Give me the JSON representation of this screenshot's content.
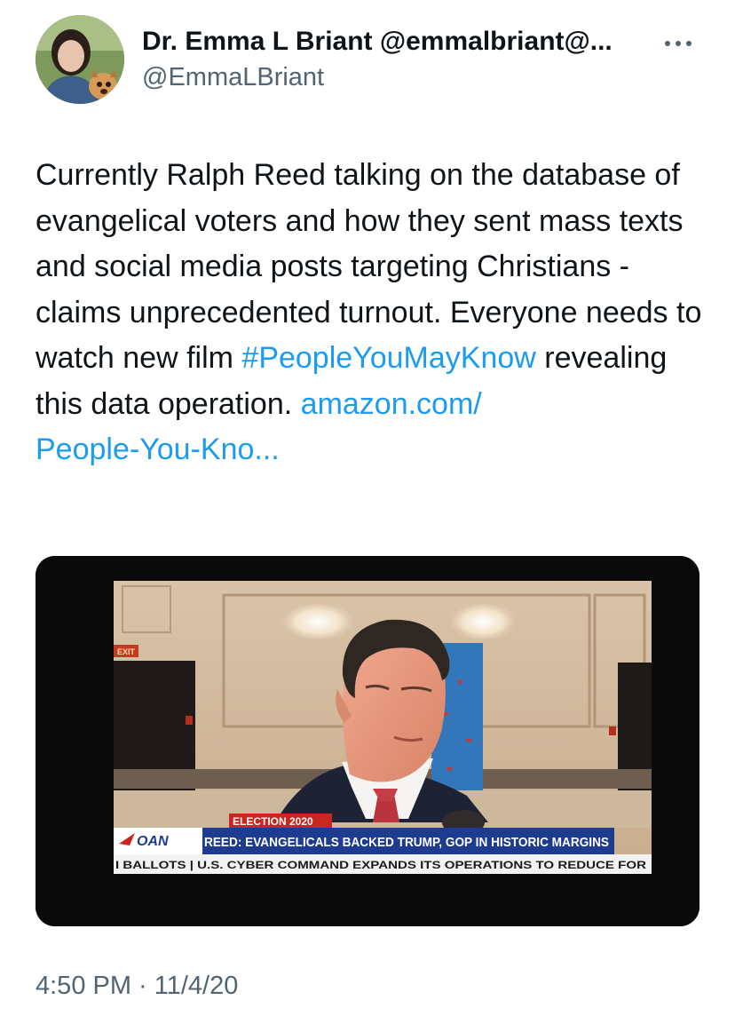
{
  "author": {
    "display_name": "Dr. Emma L Briant @emmalbriant@...",
    "handle": "@EmmaLBriant"
  },
  "tweet": {
    "text_intro": "Currently Ralph Reed talking on the database of evangelical voters and how they sent mass texts and social media posts targeting Christians - claims unprecedented turnout. Everyone needs to watch new film ",
    "hashtag": "#PeopleYouMayKnow",
    "text_after_hashtag": " revealing this data operation. ",
    "link_line1": "amazon.com/",
    "link_line2": "People-You-Kno..."
  },
  "media": {
    "exit_sign": "EXIT",
    "banner_label": "ELECTION 2020",
    "network_logo": "OAN",
    "headline": "REED: EVANGELICALS BACKED TRUMP, GOP IN HISTORIC MARGINS",
    "ticker": "I BALLOTS  |  U.S. CYBER COMMAND EXPANDS ITS OPERATIONS TO REDUCE FOR"
  },
  "timestamp": "4:50 PM · 11/4/20",
  "icons": {
    "more": "more-horizontal-icon",
    "avatar": "profile-avatar"
  },
  "colors": {
    "link": "#1d9bf0",
    "text": "#0f1419",
    "secondary": "#536471",
    "banner_red": "#c8261f",
    "banner_blue": "#1d3c8f"
  }
}
